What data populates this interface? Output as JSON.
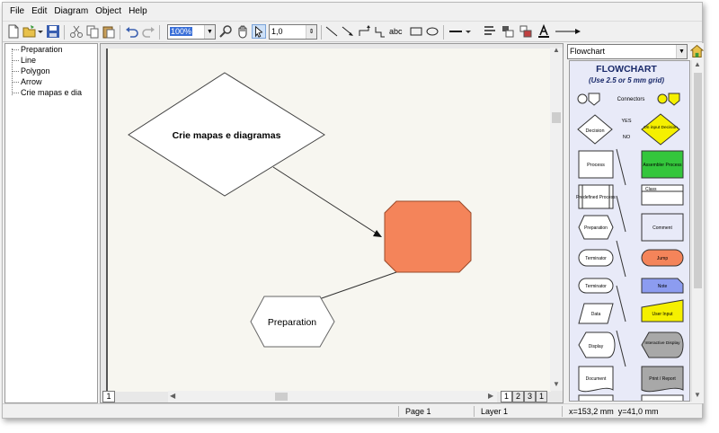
{
  "menu": {
    "file": "File",
    "edit": "Edit",
    "diagram": "Diagram",
    "object": "Object",
    "help": "Help"
  },
  "toolbar": {
    "zoom": "100%",
    "line_width": "1,0",
    "text_tool": "abc"
  },
  "tree": {
    "items": [
      "Preparation",
      "Line",
      "Polygon",
      "Arrow",
      "Crie mapas e dia"
    ]
  },
  "canvas": {
    "decision_text": "Crie mapas e diagramas",
    "preparation_text": "Preparation",
    "octagon_fill": "#f4845a",
    "page_tab_current": "1"
  },
  "page_tabs": [
    "1",
    "2",
    "3",
    "1"
  ],
  "library": {
    "selector": "Flowchart",
    "title": "FLOWCHART",
    "subtitle": "(Use 2.5 or 5 mm grid)",
    "labels": {
      "connectors": "Connectors",
      "yes": "YES",
      "no": "NO",
      "decision": "Decision",
      "on_input_decision": "On input Decision",
      "process": "Process",
      "assembler_process": "Assembler Process",
      "predefined_process": "Predefined Process",
      "class": "Class",
      "preparation": "Preparation",
      "comment": "Comment",
      "terminator1": "Terminator",
      "jump": "Jump",
      "terminator2": "Terminator",
      "note": "Note",
      "data": "Data",
      "user_input": "User Input",
      "display": "Display",
      "interactive_display": "Interactive Display",
      "document": "Document",
      "print_report": "Print / Report"
    },
    "colors": {
      "yellow": "#f5f000",
      "green": "#34c63c",
      "orange": "#f4845a",
      "blue": "#8c9cf0",
      "gray": "#a8a8a8"
    }
  },
  "status": {
    "page": "Page 1",
    "layer": "Layer 1",
    "coords": "x=153,2 mm  y=41,0 mm"
  }
}
